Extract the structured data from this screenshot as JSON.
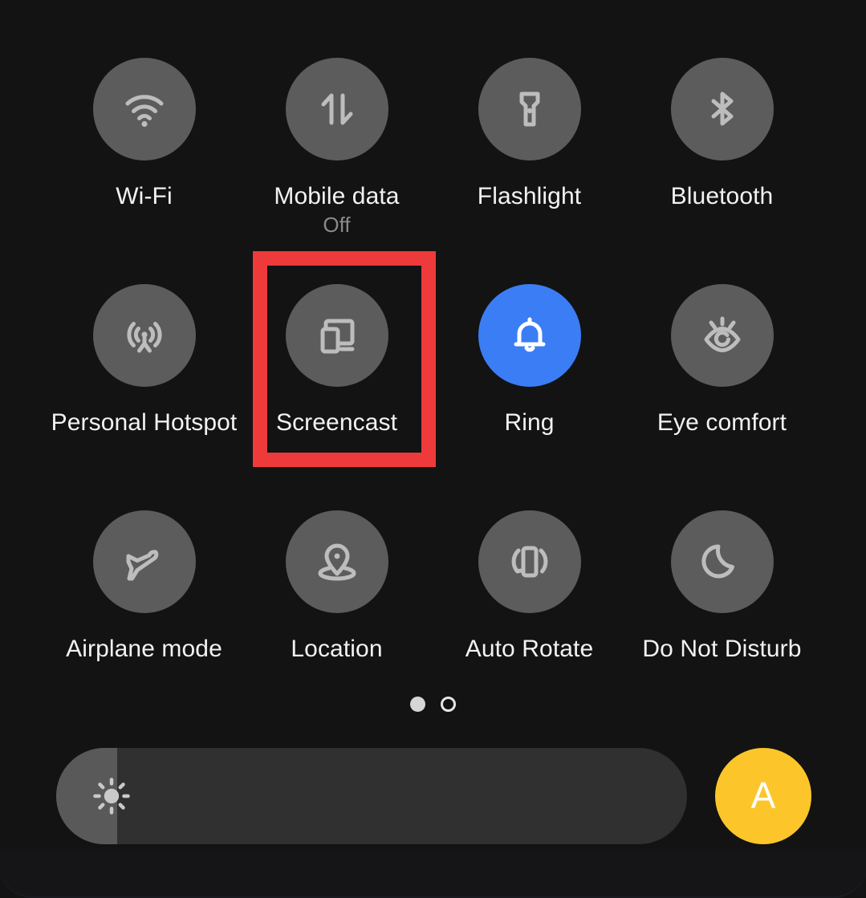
{
  "panel": {
    "name": "quick-settings-panel",
    "background_color": "#131313",
    "tile_inactive_color": "#5c5c5c",
    "tile_active_color": "#3b7df4",
    "icon_color": "#bdbdbd",
    "label_color": "#f2f2f2",
    "sublabel_color": "#8a8a8a"
  },
  "annotation": {
    "target_label": "Screencast",
    "color": "#ee3a3a",
    "border_width_px": 18
  },
  "tiles": [
    {
      "id": "wifi",
      "label": "Wi-Fi",
      "sublabel": "",
      "icon": "wifi-icon",
      "active": false
    },
    {
      "id": "mobile-data",
      "label": "Mobile data",
      "sublabel": "Off",
      "icon": "mobile-data-icon",
      "active": false
    },
    {
      "id": "flashlight",
      "label": "Flashlight",
      "sublabel": "",
      "icon": "flashlight-icon",
      "active": false
    },
    {
      "id": "bluetooth",
      "label": "Bluetooth",
      "sublabel": "",
      "icon": "bluetooth-icon",
      "active": false
    },
    {
      "id": "personal-hotspot",
      "label": "Personal Hotspot",
      "sublabel": "",
      "icon": "hotspot-icon",
      "active": false
    },
    {
      "id": "screencast",
      "label": "Screencast",
      "sublabel": "",
      "icon": "screencast-icon",
      "active": false
    },
    {
      "id": "ring",
      "label": "Ring",
      "sublabel": "",
      "icon": "bell-icon",
      "active": true
    },
    {
      "id": "eye-comfort",
      "label": "Eye comfort",
      "sublabel": "",
      "icon": "eye-comfort-icon",
      "active": false
    },
    {
      "id": "airplane-mode",
      "label": "Airplane mode",
      "sublabel": "",
      "icon": "airplane-icon",
      "active": false
    },
    {
      "id": "location",
      "label": "Location",
      "sublabel": "",
      "icon": "location-pin-icon",
      "active": false
    },
    {
      "id": "auto-rotate",
      "label": "Auto Rotate",
      "sublabel": "",
      "icon": "auto-rotate-icon",
      "active": false
    },
    {
      "id": "do-not-disturb",
      "label": "Do Not Disturb",
      "sublabel": "",
      "icon": "moon-icon",
      "active": false
    }
  ],
  "page_indicator": {
    "total_pages": 2,
    "current_page": 1,
    "dots": [
      "filled",
      "hollow"
    ]
  },
  "brightness": {
    "icon": "brightness-sun-icon",
    "level_percent": 10,
    "track_color": "#303030",
    "fill_color": "#595959",
    "auto_button": {
      "label": "A",
      "icon": "auto-brightness-icon",
      "color": "#fcc62b",
      "enabled": true
    }
  }
}
